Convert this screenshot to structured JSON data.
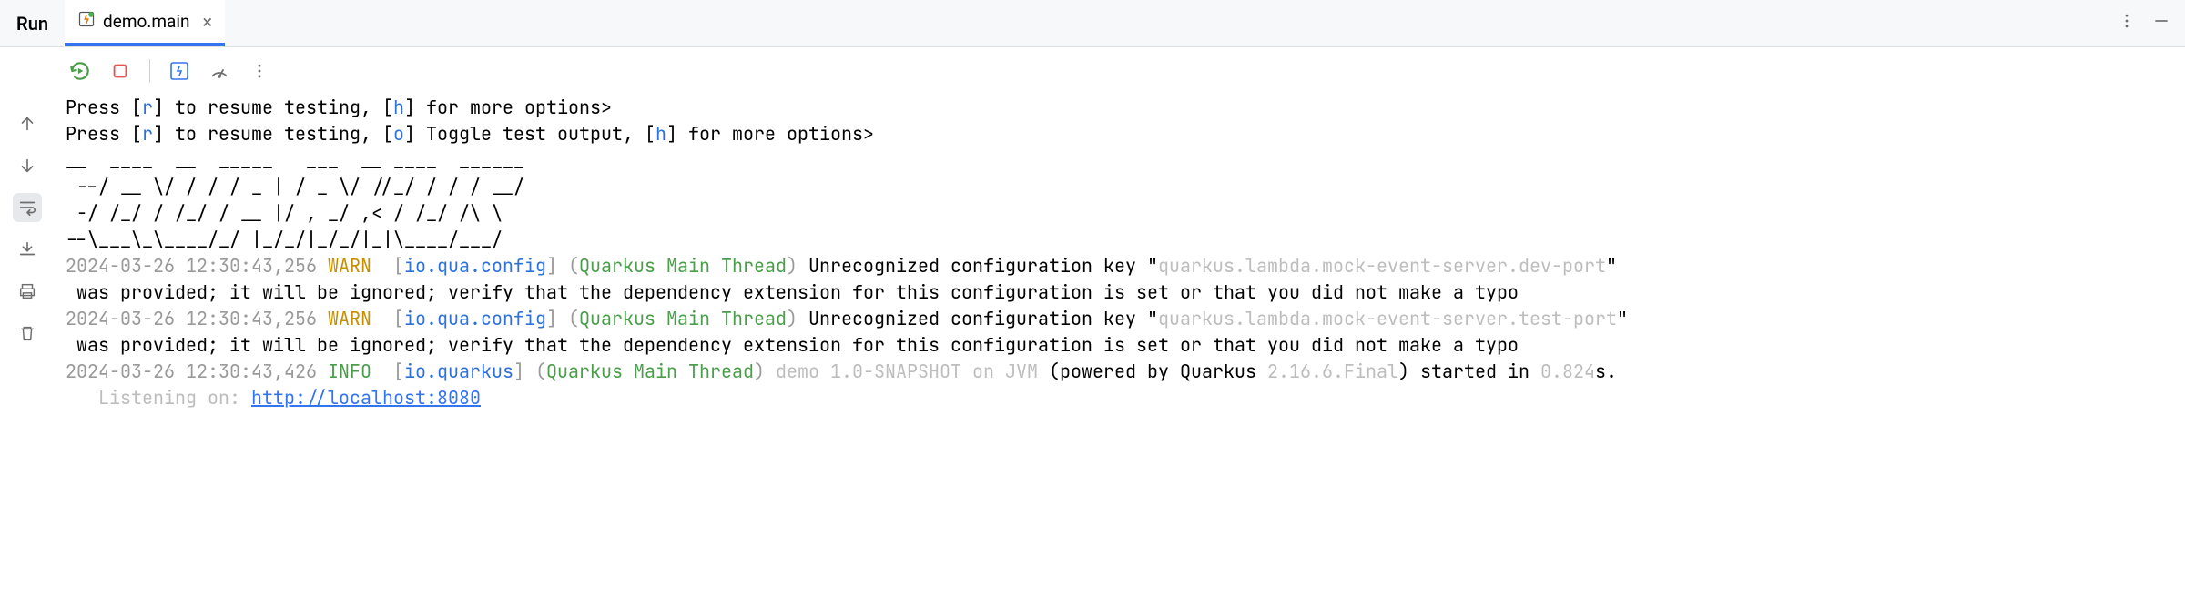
{
  "header": {
    "run_label": "Run",
    "tab_title": "demo.main"
  },
  "console": {
    "prompt1_prefix": "Press [",
    "prompt1_key_r": "r",
    "prompt1_mid1": "] to resume testing, [",
    "prompt1_key_h": "h",
    "prompt1_suffix": "] for more options>",
    "prompt2_prefix": "Press [",
    "prompt2_key_r": "r",
    "prompt2_mid1": "] to resume testing, [",
    "prompt2_key_o": "o",
    "prompt2_mid2": "] Toggle test output, [",
    "prompt2_key_h": "h",
    "prompt2_suffix": "] for more options>",
    "banner_l1": "__  ____  __  _____   ___  __ ____  ______ ",
    "banner_l2": " --/ __ \\/ / / / _ | / _ \\/ //_/ / / / __/ ",
    "banner_l3": " -/ /_/ / /_/ / __ |/ , _/ ,< / /_/ /\\ \\   ",
    "banner_l4": "--\\___\\_\\____/_/ |_/_/|_/_/|_|\\____/___/   ",
    "ts1": "2024-03-26 12:30:43,256",
    "level_warn": "WARN ",
    "logger_config": "io.qua.config",
    "thread": "Quarkus Main Thread",
    "warn_msg_pre": "Unrecognized configuration key \"",
    "warn_key1": "quarkus.lambda.mock-event-server.dev-port",
    "warn_msg_post": "\"",
    "warn_cont": " was provided; it will be ignored; verify that the dependency extension for this configuration is set or that you did not make a typo",
    "ts2": "2024-03-26 12:30:43,256",
    "warn_key2": "quarkus.lambda.mock-event-server.test-port",
    "ts3": "2024-03-26 12:30:43,426",
    "level_info": "INFO ",
    "logger_quarkus": "io.quarkus",
    "app_id": "demo 1.0-SNAPSHOT on JVM ",
    "powered_pre": "(powered by Quarkus ",
    "quarkus_version": "2.16.6.Final",
    "powered_post": ") started in ",
    "start_time": "0.824",
    "seconds_suffix": "s. ",
    "listening_prefix": "   Listening on: ",
    "listening_url": "http://localhost:8080",
    "bracket_open": "[",
    "bracket_close": "]",
    "paren_open": "(",
    "paren_close": ")"
  }
}
